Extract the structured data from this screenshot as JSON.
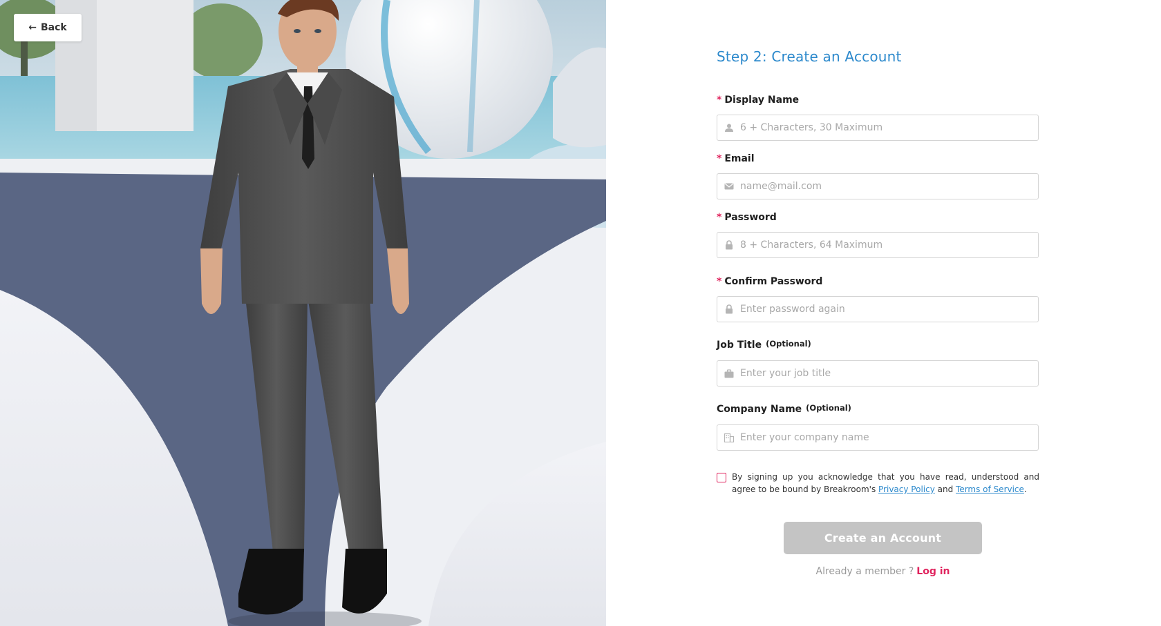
{
  "back_button": {
    "label": "Back",
    "icon": "arrow-left-icon"
  },
  "form": {
    "title": "Step 2: Create an Account",
    "required_marker": "*",
    "fields": [
      {
        "label": "Display Name",
        "required": true,
        "placeholder": "6 + Characters, 30 Maximum",
        "value": "",
        "icon": "user-icon"
      },
      {
        "label": "Email",
        "required": true,
        "placeholder": "name@mail.com",
        "value": "",
        "icon": "mail-icon"
      },
      {
        "label": "Password",
        "required": true,
        "placeholder": "8 + Characters, 64 Maximum",
        "value": "",
        "icon": "lock-icon"
      },
      {
        "label": "Confirm Password",
        "required": true,
        "placeholder": "Enter password again",
        "value": "",
        "icon": "lock-icon"
      },
      {
        "label": "Job Title",
        "optional_tag": "(Optional)",
        "placeholder": "Enter your job title",
        "value": "",
        "icon": "briefcase-icon"
      },
      {
        "label": "Company Name",
        "optional_tag": "(Optional)",
        "placeholder": "Enter your company name",
        "value": "",
        "icon": "building-icon"
      }
    ],
    "consent": {
      "checked": false,
      "text_before": "By signing up you acknowledge that you have read, understood and agree to be bound by Breakroom's ",
      "privacy_link": "Privacy Policy",
      "text_middle": " and ",
      "terms_link": "Terms of Service",
      "text_after": "."
    },
    "submit_label": "Create an Account",
    "member_prompt": "Already a member ?",
    "login_link": "Log in"
  },
  "colors": {
    "accent_blue": "#2c89cc",
    "accent_pink": "#e0245e",
    "button_disabled": "#c4c4c4",
    "placeholder": "#a8a8a8"
  }
}
